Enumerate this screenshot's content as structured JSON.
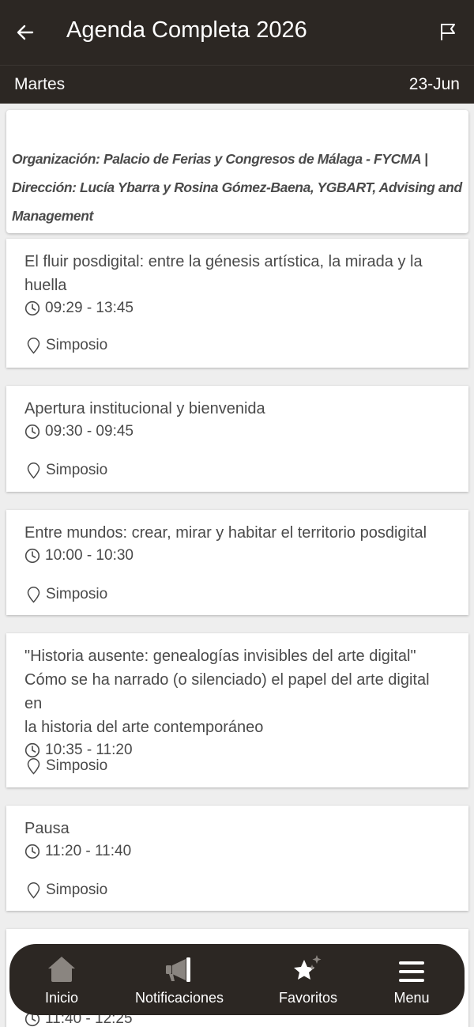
{
  "header": {
    "title": "Agenda Completa 2026"
  },
  "daybar": {
    "day": "Martes",
    "date": "23-Jun"
  },
  "organization": {
    "line1": "Organización: Palacio de Ferias y Congresos de Málaga - FYCMA |",
    "line2": "Dirección: Lucía Ybarra y Rosina Gómez-Baena, YGBART, Advising and",
    "line3": "Management"
  },
  "sessions": [
    {
      "title_lines": [
        "El fluir posdigital: entre la génesis artística, la mirada y la",
        "huella"
      ],
      "time": "09:29 - 13:45",
      "location": "Simposio"
    },
    {
      "title_lines": [
        "Apertura institucional y bienvenida"
      ],
      "time": "09:30 - 09:45",
      "location": "Simposio"
    },
    {
      "title_lines": [
        "Entre mundos: crear, mirar y habitar el territorio posdigital"
      ],
      "time": "10:00 - 10:30",
      "location": "Simposio"
    },
    {
      "title_lines": [
        "\"Historia ausente: genealogías invisibles del arte digital\"",
        "Cómo se ha narrado (o silenciado) el papel del arte digital en",
        "la historia del arte contemporáneo"
      ],
      "time": "10:35 - 11:20",
      "location": "Simposio"
    },
    {
      "title_lines": [
        "Pausa"
      ],
      "time": "11:20 - 11:40",
      "location": "Simposio"
    },
    {
      "title_lines": [],
      "time": "11:40 - 12:25",
      "location": ""
    }
  ],
  "nav": {
    "home": "Inicio",
    "notifications": "Notificaciones",
    "favorites": "Favoritos",
    "menu": "Menu"
  },
  "icons": {
    "back": "arrow-left-icon",
    "flag": "flag-icon",
    "clock": "clock-icon",
    "location": "map-pin-icon",
    "home": "home-icon",
    "notifications": "megaphone-icon",
    "favorites": "star-sparkle-icon",
    "menu": "hamburger-icon"
  },
  "colors": {
    "bar": "#2c2723",
    "background": "#eeeeee",
    "card": "#ffffff",
    "text": "#4a4a4a"
  }
}
